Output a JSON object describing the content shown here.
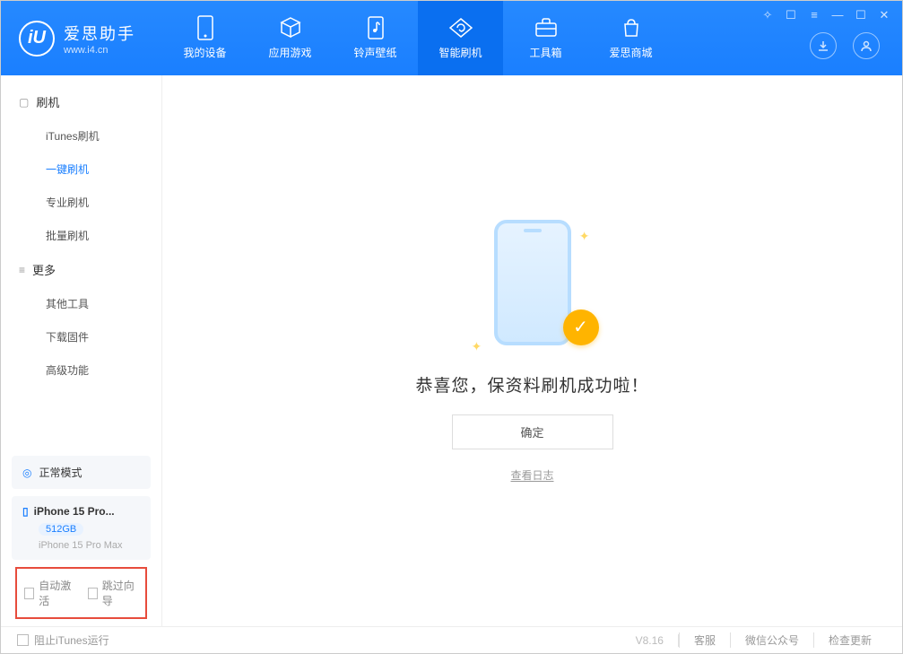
{
  "app": {
    "title": "爱思助手",
    "subtitle": "www.i4.cn",
    "version": "V8.16"
  },
  "nav": {
    "tabs": [
      {
        "label": "我的设备",
        "icon": "phone"
      },
      {
        "label": "应用游戏",
        "icon": "cube"
      },
      {
        "label": "铃声壁纸",
        "icon": "music"
      },
      {
        "label": "智能刷机",
        "icon": "refresh",
        "active": true
      },
      {
        "label": "工具箱",
        "icon": "toolbox"
      },
      {
        "label": "爱思商城",
        "icon": "store"
      }
    ]
  },
  "sidebar": {
    "groups": [
      {
        "label": "刷机",
        "icon": "phone-small",
        "items": [
          "iTunes刷机",
          "一键刷机",
          "专业刷机",
          "批量刷机"
        ],
        "active_index": 1
      },
      {
        "label": "更多",
        "icon": "more",
        "items": [
          "其他工具",
          "下载固件",
          "高级功能"
        ],
        "active_index": -1
      }
    ],
    "mode": {
      "label": "正常模式"
    },
    "device": {
      "name": "iPhone 15 Pro...",
      "storage": "512GB",
      "model": "iPhone 15 Pro Max"
    },
    "options": {
      "auto_activate": "自动激活",
      "skip_guide": "跳过向导"
    }
  },
  "main": {
    "success_text": "恭喜您，保资料刷机成功啦！",
    "ok_button": "确定",
    "log_link": "查看日志"
  },
  "footer": {
    "block_itunes": "阻止iTunes运行",
    "links": [
      "客服",
      "微信公众号",
      "检查更新"
    ]
  }
}
